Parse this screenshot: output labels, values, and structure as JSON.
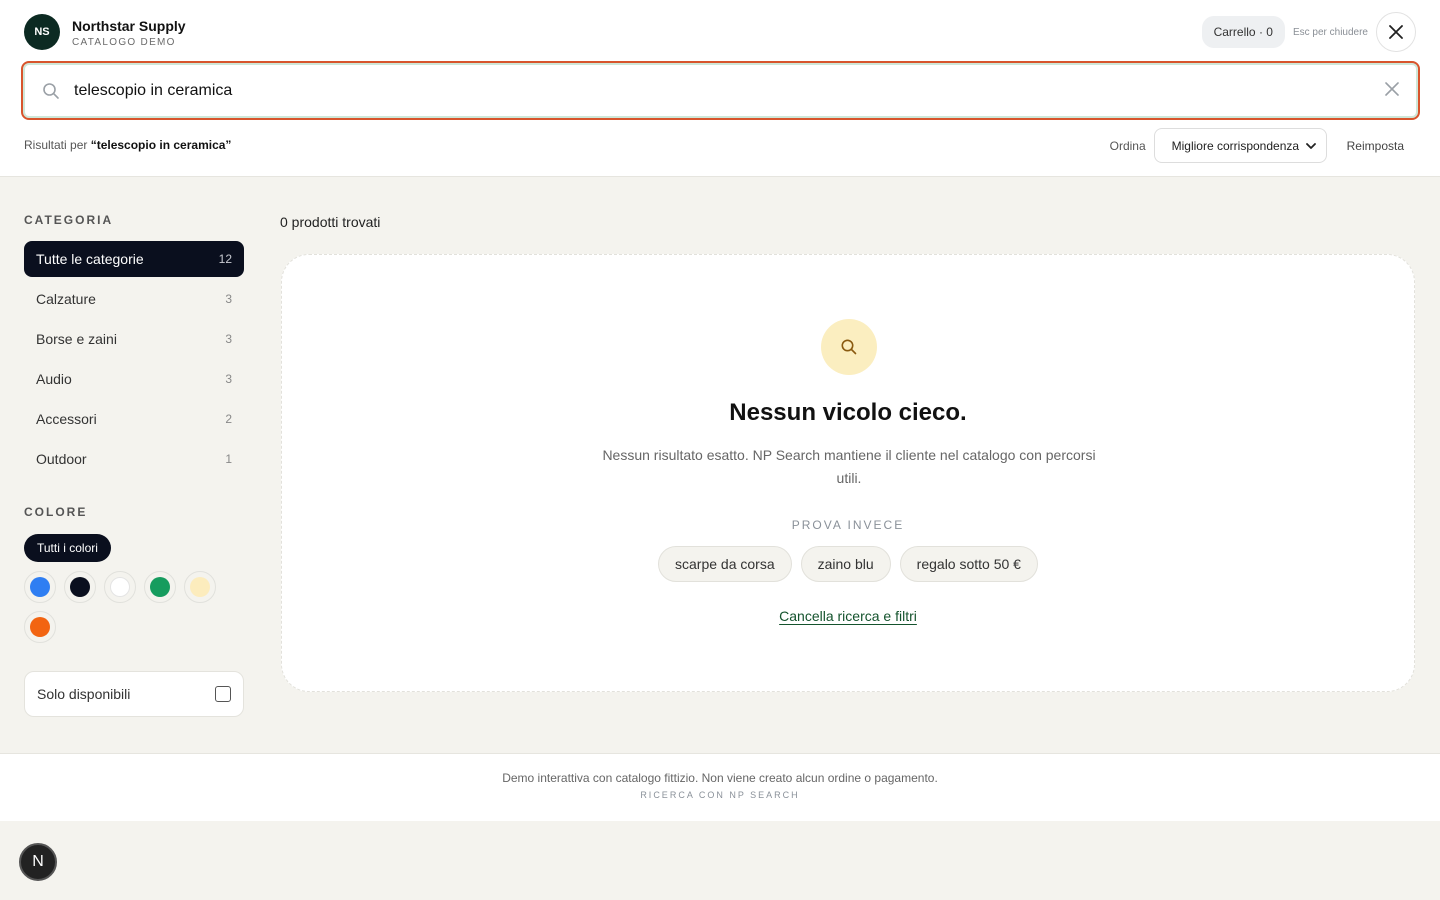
{
  "brand": {
    "initials": "NS",
    "name": "Northstar Supply",
    "subtitle": "CATALOGO DEMO"
  },
  "header": {
    "cart_label": "Carrello · 0",
    "esc_hint": "Esc per chiudere",
    "close_icon": "close-icon"
  },
  "search": {
    "value": "telescopio in ceramica",
    "search_icon": "search-icon",
    "clear_icon": "clear-icon"
  },
  "results": {
    "prefix": "Risultati per",
    "query_quoted": "“telescopio in ceramica”"
  },
  "sort": {
    "label": "Ordina",
    "selected": "Migliore corrispondenza",
    "reset_label": "Reimposta"
  },
  "sidebar": {
    "category_title": "CATEGORIA",
    "categories": [
      {
        "label": "Tutte le categorie",
        "count": "12",
        "active": true
      },
      {
        "label": "Calzature",
        "count": "3"
      },
      {
        "label": "Borse e zaini",
        "count": "3"
      },
      {
        "label": "Audio",
        "count": "3"
      },
      {
        "label": "Accessori",
        "count": "2"
      },
      {
        "label": "Outdoor",
        "count": "1"
      }
    ],
    "color_title": "COLORE",
    "all_colors_label": "Tutti i colori",
    "colors": [
      "#2f7ef2",
      "#0a0f1e",
      "#ffffff",
      "#169c5e",
      "#fcecbd",
      "#f26411"
    ],
    "available_label": "Solo disponibili"
  },
  "main": {
    "found_label": "0 prodotti trovati",
    "empty_title": "Nessun vicolo cieco.",
    "empty_text": "Nessun risultato esatto. NP Search mantiene il cliente nel catalogo con percorsi utili.",
    "try_label": "PROVA INVECE",
    "suggestions": [
      "scarpe da corsa",
      "zaino blu",
      "regalo sotto 50 €"
    ],
    "clear_link": "Cancella ricerca e filtri"
  },
  "footer": {
    "note": "Demo interattiva con catalogo fittizio. Non viene creato alcun ordine o pagamento.",
    "brand_line": "RICERCA CON NP SEARCH"
  },
  "badge": {
    "letter": "N"
  },
  "colors": {
    "accent_border": "#d8542c",
    "brand_dark": "#0c2a22",
    "link_green": "#14532d",
    "empty_icon_bg": "#fbeec0"
  }
}
